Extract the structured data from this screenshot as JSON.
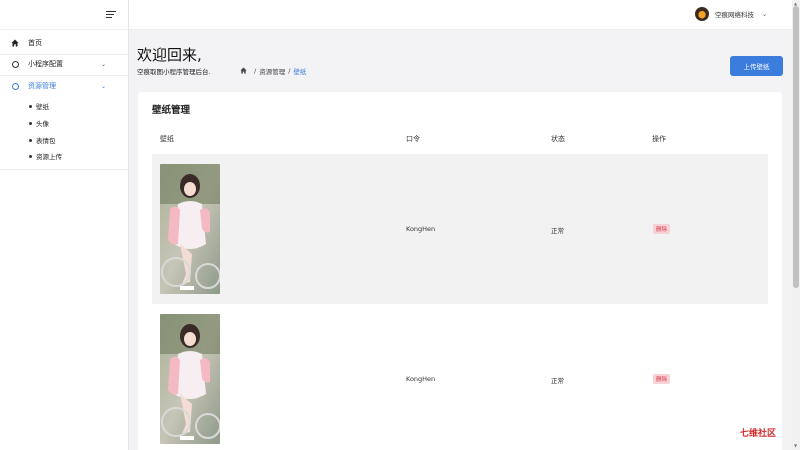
{
  "sidebar": {
    "items": [
      {
        "label": "首页",
        "icon": "home-icon"
      },
      {
        "label": "小程序配置",
        "icon": "circle-icon"
      },
      {
        "label": "资源管理",
        "icon": "circle-icon"
      }
    ],
    "sub_items": [
      {
        "label": "壁纸"
      },
      {
        "label": "头像"
      },
      {
        "label": "表情包"
      },
      {
        "label": "资源上传"
      }
    ]
  },
  "topbar": {
    "user_name": "空痕网络科技"
  },
  "header": {
    "welcome": "欢迎回来,",
    "subtitle": "空痕取图小程序管理后台."
  },
  "breadcrumb": {
    "items": [
      "资源管理",
      "壁纸"
    ]
  },
  "actions": {
    "upload_label": "上传壁纸"
  },
  "table": {
    "title": "壁纸管理",
    "columns": [
      "壁纸",
      "口令",
      "状态",
      "操作"
    ],
    "rows": [
      {
        "password": "KongHen",
        "status": "正常",
        "action": "删除"
      },
      {
        "password": "KongHen",
        "status": "正常",
        "action": "删除"
      }
    ]
  },
  "watermark": "七维社区",
  "colors": {
    "accent": "#3b7ddd",
    "danger": "#d63447",
    "danger_bg": "#f6d2d6"
  }
}
